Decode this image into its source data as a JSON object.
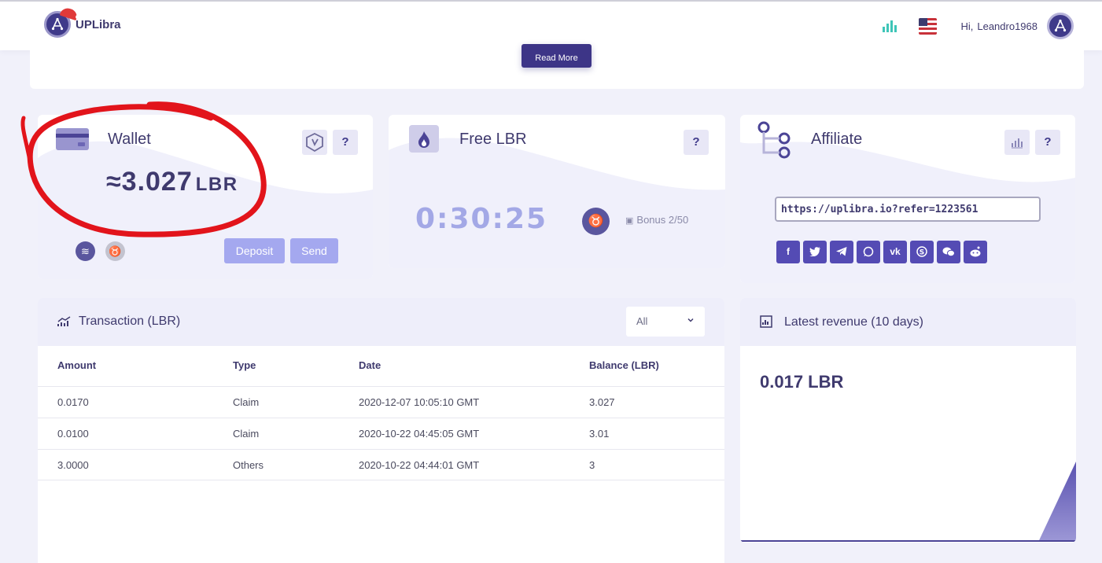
{
  "header": {
    "logo_text": "UPLibra",
    "greeting": "Hi,",
    "username": "Leandro1968"
  },
  "banner": {
    "read_more_label": "Read More"
  },
  "wallet": {
    "title": "Wallet",
    "balance_prefix": "≈",
    "balance_value": "3.027",
    "balance_unit": "LBR",
    "help_label": "?",
    "deposit_label": "Deposit",
    "send_label": "Send"
  },
  "free_lbr": {
    "title": "Free LBR",
    "help_label": "?",
    "countdown": "0:30:25",
    "bonus_text": "Bonus 2/50"
  },
  "affiliate": {
    "title": "Affiliate",
    "help_label": "?",
    "referral_link": "https://uplibra.io?refer=1223561",
    "socials": [
      "facebook-icon",
      "twitter-icon",
      "telegram-icon",
      "whatsapp-icon",
      "vk-icon",
      "skype-icon",
      "wechat-icon",
      "reddit-icon"
    ]
  },
  "transactions": {
    "title": "Transaction (LBR)",
    "filter_value": "All",
    "columns": [
      "Amount",
      "Type",
      "Date",
      "Balance (LBR)"
    ],
    "rows": [
      [
        "0.0170",
        "Claim",
        "2020-12-07 10:05:10 GMT",
        "3.027"
      ],
      [
        "0.0100",
        "Claim",
        "2020-10-22 04:45:05 GMT",
        "3.01"
      ],
      [
        "3.0000",
        "Others",
        "2020-10-22 04:44:01 GMT",
        "3"
      ]
    ]
  },
  "revenue": {
    "title": "Latest revenue (10 days)",
    "total": "0.017 LBR",
    "chart_values": [
      0,
      0,
      0,
      0,
      0,
      0,
      0,
      0,
      0,
      0.017
    ]
  },
  "colors": {
    "brand_dark": "#3d3587",
    "accent_light": "#a4a8ef",
    "annotation_red": "#e2141b"
  }
}
